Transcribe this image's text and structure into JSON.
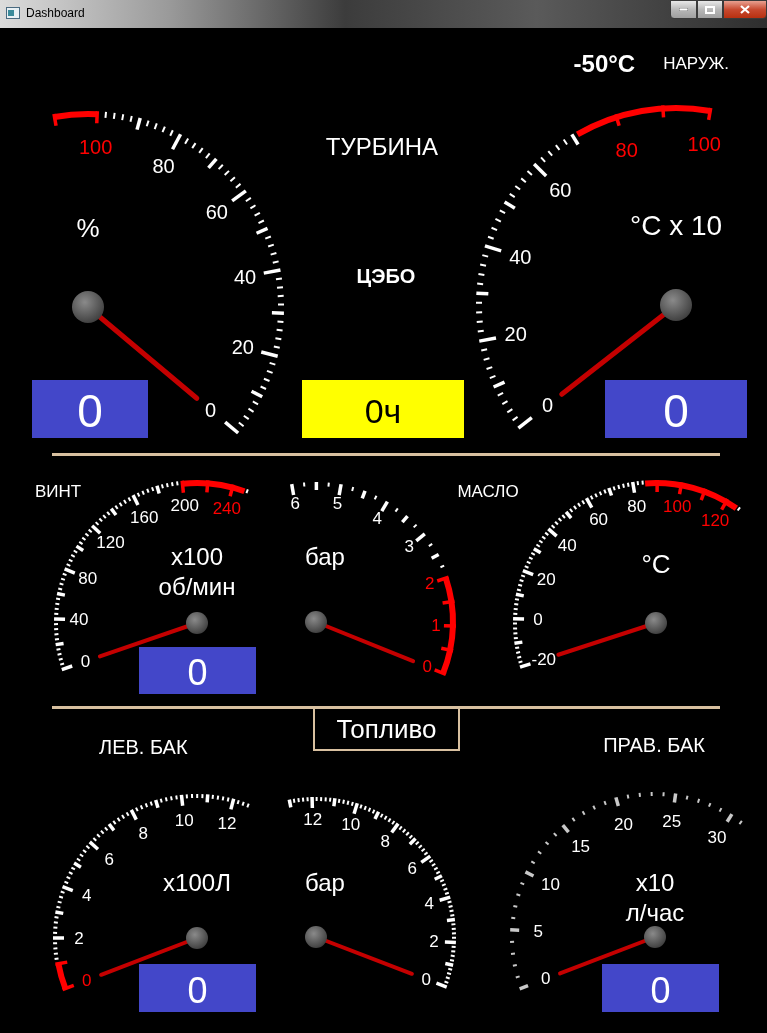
{
  "window": {
    "title": "Dashboard"
  },
  "outside_air": {
    "temperature": "-50°C",
    "label": "НАРУЖ."
  },
  "turbine": {
    "title": "ТУРБИНА",
    "gauges": [
      {
        "unit": [
          "%"
        ],
        "labels": [
          {
            "text": "0",
            "warning": false
          },
          {
            "text": "20",
            "warning": false
          },
          {
            "text": "40",
            "warning": false
          },
          {
            "text": "60",
            "warning": false
          },
          {
            "text": "80",
            "warning": false
          },
          {
            "text": "100",
            "warning": true
          }
        ],
        "value": "0"
      },
      {
        "unit": [
          "°C x 10"
        ],
        "labels": [
          {
            "text": "0",
            "warning": false
          },
          {
            "text": "20",
            "warning": false
          },
          {
            "text": "40",
            "warning": false
          },
          {
            "text": "60",
            "warning": false
          },
          {
            "text": "80",
            "warning": true
          },
          {
            "text": "100",
            "warning": true
          }
        ],
        "value": "0"
      }
    ]
  },
  "apu": {
    "title": "ЦЭБО",
    "hours": "0ч"
  },
  "engine": {
    "propeller_label": "ВИНТ",
    "oil_label": "МАСЛО",
    "gauges": [
      {
        "unit": [
          "x100",
          "об/мин"
        ],
        "labels": [
          {
            "text": "240",
            "warning": true
          },
          {
            "text": "200",
            "warning": false
          },
          {
            "text": "160",
            "warning": false
          },
          {
            "text": "120",
            "warning": false
          },
          {
            "text": "80",
            "warning": false
          },
          {
            "text": "40",
            "warning": false
          },
          {
            "text": "0",
            "warning": false
          }
        ],
        "value": "0"
      },
      {
        "unit": [
          "бар"
        ],
        "labels": [
          {
            "text": "0",
            "warning": true
          },
          {
            "text": "1",
            "warning": true
          },
          {
            "text": "2",
            "warning": true
          },
          {
            "text": "3",
            "warning": false
          },
          {
            "text": "4",
            "warning": false
          },
          {
            "text": "5",
            "warning": false
          },
          {
            "text": "6",
            "warning": false
          }
        ]
      },
      {
        "unit": [
          "°C"
        ],
        "labels": [
          {
            "text": "120",
            "warning": true
          },
          {
            "text": "100",
            "warning": true
          },
          {
            "text": "80",
            "warning": false
          },
          {
            "text": "60",
            "warning": false
          },
          {
            "text": "40",
            "warning": false
          },
          {
            "text": "20",
            "warning": false
          },
          {
            "text": "0",
            "warning": false
          },
          {
            "text": "-20",
            "warning": false
          }
        ]
      }
    ]
  },
  "fuel": {
    "title": "Топливо",
    "left_tank": "ЛЕВ. БАК",
    "right_tank": "ПРАВ. БАК",
    "gauges": [
      {
        "unit": [
          "x100Л"
        ],
        "labels": [
          {
            "text": "0",
            "warning": true
          },
          {
            "text": "2",
            "warning": false
          },
          {
            "text": "4",
            "warning": false
          },
          {
            "text": "6",
            "warning": false
          },
          {
            "text": "8",
            "warning": false
          },
          {
            "text": "10",
            "warning": false
          },
          {
            "text": "12",
            "warning": false
          }
        ],
        "value": "0"
      },
      {
        "unit": [
          "бар"
        ],
        "labels": [
          {
            "text": "0",
            "warning": false
          },
          {
            "text": "2",
            "warning": false
          },
          {
            "text": "4",
            "warning": false
          },
          {
            "text": "6",
            "warning": false
          },
          {
            "text": "8",
            "warning": false
          },
          {
            "text": "10",
            "warning": false
          },
          {
            "text": "12",
            "warning": false
          }
        ]
      },
      {
        "unit": [
          "x10",
          "л/час"
        ],
        "labels": [
          {
            "text": "0",
            "warning": false
          },
          {
            "text": "5",
            "warning": false
          },
          {
            "text": "10",
            "warning": false
          },
          {
            "text": "15",
            "warning": false
          },
          {
            "text": "20",
            "warning": false
          },
          {
            "text": "25",
            "warning": false
          },
          {
            "text": "30",
            "warning": false
          }
        ],
        "value": "0"
      }
    ]
  }
}
